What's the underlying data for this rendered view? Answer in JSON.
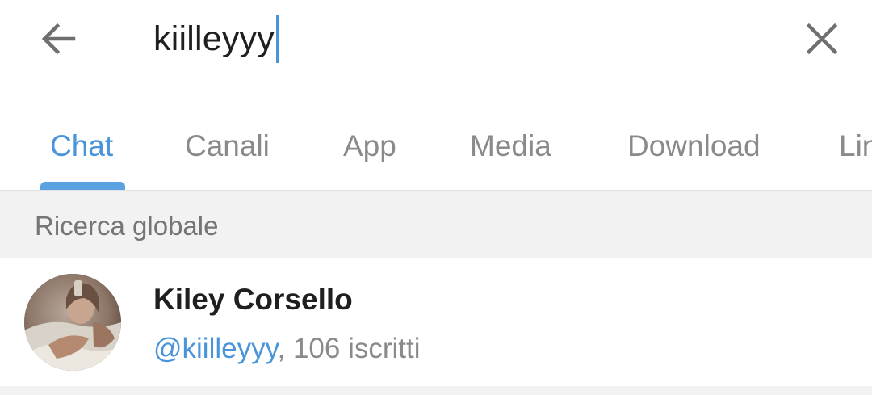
{
  "search": {
    "query": "kiilleyyy"
  },
  "icons": {
    "back": "arrow-left-icon",
    "clear": "close-icon"
  },
  "tabs": [
    {
      "label": "Chat",
      "active": true
    },
    {
      "label": "Canali",
      "active": false
    },
    {
      "label": "App",
      "active": false
    },
    {
      "label": "Media",
      "active": false
    },
    {
      "label": "Download",
      "active": false
    },
    {
      "label": "Link",
      "active": false
    }
  ],
  "section": {
    "title": "Ricerca globale"
  },
  "results": [
    {
      "name": "Kiley Corsello",
      "username": "@kiilleyyy",
      "subscribers": ", 106 iscritti"
    }
  ],
  "colors": {
    "accent": "#4a95d9",
    "tab_inactive": "#8a8a8a",
    "section_bg": "#f2f2f2",
    "text_primary": "#1f1f1f"
  }
}
